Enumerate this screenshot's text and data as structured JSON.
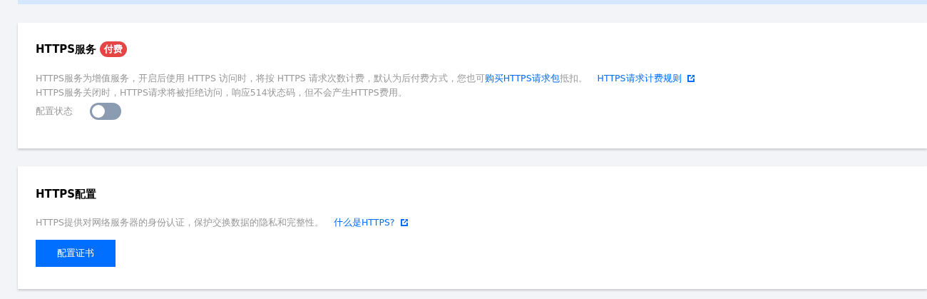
{
  "service": {
    "title": "HTTPS服务",
    "badge": "付费",
    "description": [
      {
        "kind": "text",
        "text": "HTTPS服务为增值服务，开启后使用 HTTPS 访问时，将按 HTTPS 请求次数计费，默认为后付费方式，您也可"
      },
      {
        "kind": "link",
        "text": "购买HTTPS请求包"
      },
      {
        "kind": "text",
        "text": "抵扣。"
      }
    ],
    "rule_link": "HTTPS请求计费规则",
    "note": "HTTPS服务关闭时，HTTPS请求将被拒绝访问，响应514状态码，但不会产生HTTPS费用。",
    "status_label": "配置状态",
    "status_on": false
  },
  "config": {
    "title": "HTTPS配置",
    "description": "HTTPS提供对网络服务器的身份认证，保护交换数据的隐私和完整性。",
    "help_link": "什么是HTTPS?",
    "button": "配置证书"
  }
}
